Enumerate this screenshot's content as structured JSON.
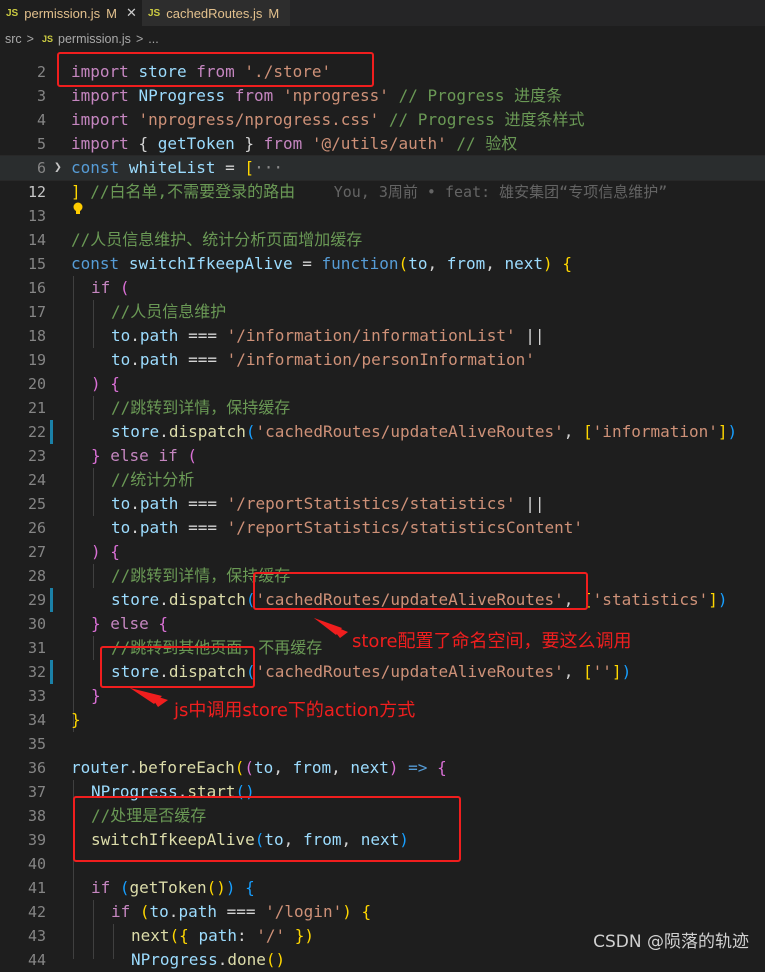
{
  "tabs": [
    {
      "icon": "JS",
      "name": "permission.js",
      "status": "M"
    },
    {
      "icon": "JS",
      "name": "cachedRoutes.js",
      "status": "M"
    }
  ],
  "breadcrumb": {
    "folder": "src",
    "sep1": ">",
    "icon": "JS",
    "file": "permission.js",
    "sep2": ">",
    "more": "..."
  },
  "line_numbers": [
    "2",
    "3",
    "4",
    "5",
    "6",
    "12",
    "13",
    "14",
    "15",
    "16",
    "17",
    "18",
    "19",
    "20",
    "21",
    "22",
    "23",
    "24",
    "25",
    "26",
    "27",
    "28",
    "29",
    "30",
    "31",
    "32",
    "33",
    "34",
    "35",
    "36",
    "37",
    "38",
    "39",
    "40",
    "41",
    "42",
    "43",
    "44"
  ],
  "code": {
    "l2": [
      "import",
      "store",
      "from",
      "'./store'"
    ],
    "l3": [
      "import",
      "NProgress",
      "from",
      "'nprogress'",
      "// Progress 进度条"
    ],
    "l4": [
      "import",
      "'nprogress/nprogress.css'",
      "// Progress 进度条样式"
    ],
    "l5": [
      "import",
      "{ ",
      "getToken",
      " } ",
      "from",
      "'@/utils/auth'",
      "// 验权"
    ],
    "l6": [
      "const",
      "whiteList",
      " = ",
      "[",
      "···"
    ],
    "l12": [
      "]",
      "//白名单,不需要登录的路由",
      "You, 3周前 • feat: 雄安集团“专项信息维护”"
    ],
    "l14": "//人员信息维护、统计分析页面增加缓存",
    "l15": [
      "const",
      "switchIfkeepAlive",
      " = ",
      "function",
      "(",
      "to",
      ", ",
      "from",
      ", ",
      "next",
      ") ",
      "{"
    ],
    "l16": [
      "if",
      " ("
    ],
    "l17": "//人员信息维护",
    "l18": [
      "to",
      "path",
      " === ",
      "'/information/informationList'",
      " ||"
    ],
    "l19": [
      "to",
      "path",
      " === ",
      "'/information/personInformation'"
    ],
    "l20": [
      ") {"
    ],
    "l21": "//跳转到详情，保持缓存",
    "l22": [
      "store",
      "dispatch",
      "(",
      "'cachedRoutes/updateAliveRoutes'",
      ", ",
      "[",
      "'information'",
      "]",
      ")"
    ],
    "l23": [
      "} ",
      "else",
      " ",
      "if",
      " ("
    ],
    "l24": "//统计分析",
    "l25": [
      "to",
      "path",
      " === ",
      "'/reportStatistics/statistics'",
      " ||"
    ],
    "l26": [
      "to",
      "path",
      " === ",
      "'/reportStatistics/statisticsContent'"
    ],
    "l27": [
      ") {"
    ],
    "l28": "//跳转到详情，保持缓存",
    "l29": [
      "store",
      "dispatch",
      "(",
      "'cachedRoutes/updateAliveRoutes'",
      ", ",
      "[",
      "'statistics'",
      "]",
      ")"
    ],
    "l30": [
      "} ",
      "else",
      " {"
    ],
    "l31": "//跳转到其他页面，不再缓存",
    "l32": [
      "store",
      "dispatch",
      "(",
      "'cachedRoutes/updateAliveRoutes'",
      ", ",
      "[",
      "''",
      "]",
      ")"
    ],
    "l33": "}",
    "l34": "}",
    "l36": [
      "router",
      "beforeEach",
      "(",
      "(",
      "to",
      ", ",
      "from",
      ", ",
      "next",
      ") ",
      "=>",
      " {"
    ],
    "l37": [
      "NProgress",
      "start",
      "()"
    ],
    "l38": "//处理是否缓存",
    "l39": [
      "switchIfkeepAlive",
      "(",
      "to",
      ", ",
      "from",
      ", ",
      "next",
      ")"
    ],
    "l41": [
      "if",
      " (",
      "getToken",
      "()",
      ")",
      " {"
    ],
    "l42": [
      "if",
      " (",
      "to",
      "path",
      " === ",
      "'/login'",
      ") {"
    ],
    "l43": [
      "next",
      "({ ",
      "path",
      ": ",
      "'/'",
      " })"
    ],
    "l44": [
      "NProgress",
      "done",
      "()"
    ]
  },
  "annotations": {
    "namespace_note": "store配置了命名空间，要这么调用",
    "action_note": "js中调用store下的action方式"
  },
  "watermark": "CSDN @陨落的轨迹",
  "colors": {
    "annotation": "#f01e1e",
    "background": "#1e1e1e",
    "keyword": "#569cd6",
    "control": "#c586c0",
    "string": "#ce9178",
    "comment": "#6a9955",
    "variable": "#9cdcfe",
    "function": "#dcdcaa"
  }
}
